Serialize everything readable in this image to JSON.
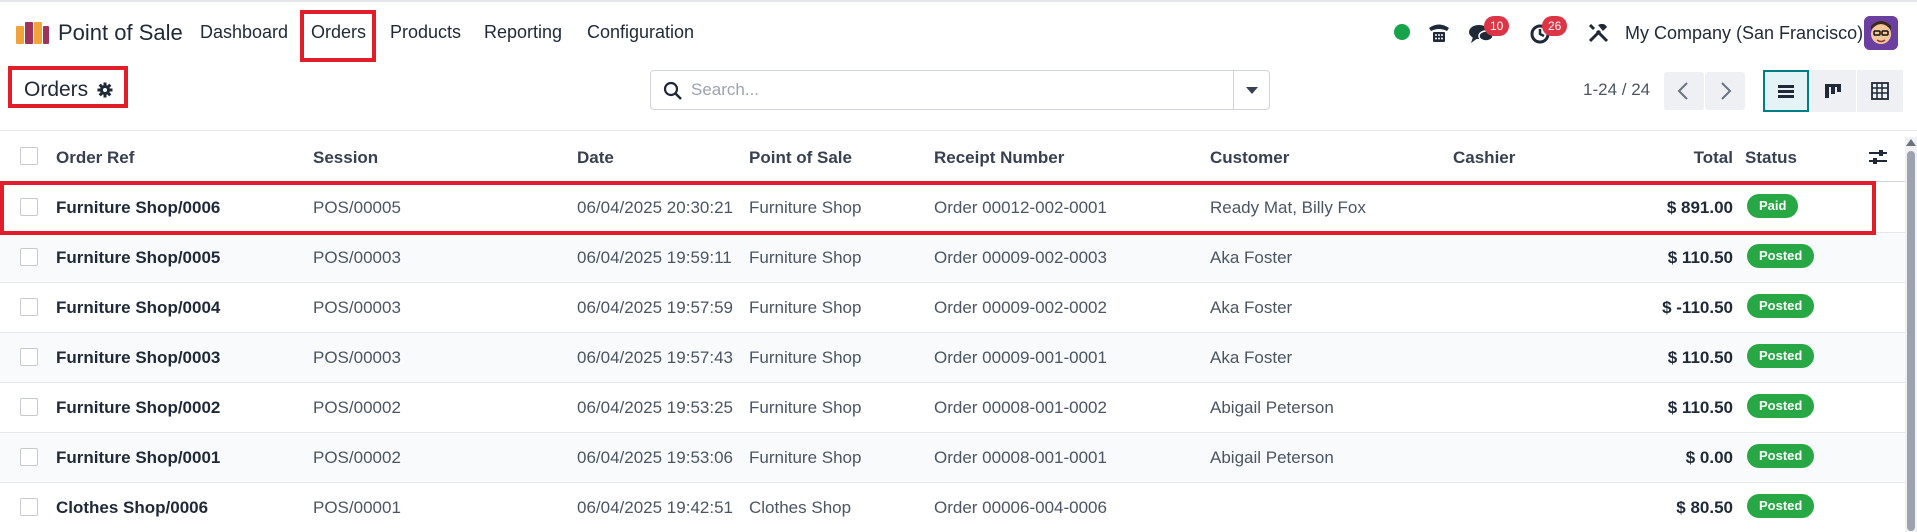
{
  "navbar": {
    "app_title": "Point of Sale",
    "menu": [
      "Dashboard",
      "Orders",
      "Products",
      "Reporting",
      "Configuration"
    ],
    "messages_badge": "10",
    "activities_badge": "26",
    "company": "My Company (San Francisco)",
    "status_color": "#16a34a"
  },
  "control_panel": {
    "title": "Orders",
    "search_placeholder": "Search...",
    "pager": "1-24 / 24"
  },
  "table": {
    "columns": {
      "order_ref": "Order Ref",
      "session": "Session",
      "date": "Date",
      "pos": "Point of Sale",
      "receipt": "Receipt Number",
      "customer": "Customer",
      "cashier": "Cashier",
      "total": "Total",
      "status": "Status"
    },
    "rows": [
      {
        "ref": "Furniture Shop/0006",
        "session": "POS/00005",
        "date": "06/04/2025 20:30:21",
        "pos": "Furniture Shop",
        "receipt": "Order 00012-002-0001",
        "customer": "Ready Mat, Billy Fox",
        "cashier": "",
        "total": "$ 891.00",
        "status": "Paid"
      },
      {
        "ref": "Furniture Shop/0005",
        "session": "POS/00003",
        "date": "06/04/2025 19:59:11",
        "pos": "Furniture Shop",
        "receipt": "Order 00009-002-0003",
        "customer": "Aka Foster",
        "cashier": "",
        "total": "$ 110.50",
        "status": "Posted"
      },
      {
        "ref": "Furniture Shop/0004",
        "session": "POS/00003",
        "date": "06/04/2025 19:57:59",
        "pos": "Furniture Shop",
        "receipt": "Order 00009-002-0002",
        "customer": "Aka Foster",
        "cashier": "",
        "total": "$ -110.50",
        "status": "Posted"
      },
      {
        "ref": "Furniture Shop/0003",
        "session": "POS/00003",
        "date": "06/04/2025 19:57:43",
        "pos": "Furniture Shop",
        "receipt": "Order 00009-001-0001",
        "customer": "Aka Foster",
        "cashier": "",
        "total": "$ 110.50",
        "status": "Posted"
      },
      {
        "ref": "Furniture Shop/0002",
        "session": "POS/00002",
        "date": "06/04/2025 19:53:25",
        "pos": "Furniture Shop",
        "receipt": "Order 00008-001-0002",
        "customer": "Abigail Peterson",
        "cashier": "",
        "total": "$ 110.50",
        "status": "Posted"
      },
      {
        "ref": "Furniture Shop/0001",
        "session": "POS/00002",
        "date": "06/04/2025 19:53:06",
        "pos": "Furniture Shop",
        "receipt": "Order 00008-001-0001",
        "customer": "Abigail Peterson",
        "cashier": "",
        "total": "$ 0.00",
        "status": "Posted"
      },
      {
        "ref": "Clothes Shop/0006",
        "session": "POS/00001",
        "date": "06/04/2025 19:42:51",
        "pos": "Clothes Shop",
        "receipt": "Order 00006-004-0006",
        "customer": "",
        "cashier": "",
        "total": "$ 80.50",
        "status": "Posted"
      }
    ]
  },
  "colors": {
    "highlight": "#e11d2a",
    "status_green": "#28a745",
    "badge_red": "#dc3545",
    "accent_teal": "#017e84"
  }
}
